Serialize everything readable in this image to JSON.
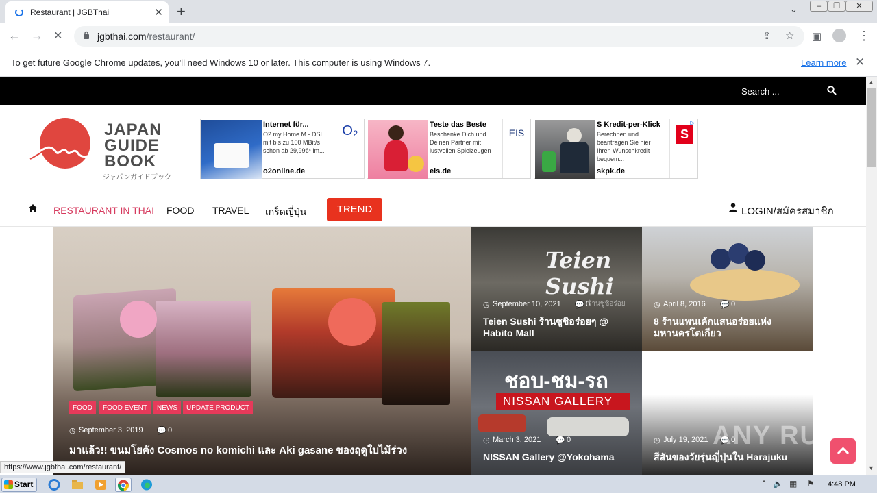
{
  "browser": {
    "tab_title": "Restaurant | JGBThai",
    "url_host": "jgbthai.com",
    "url_path": "/restaurant/",
    "update_message": "To get future Google Chrome updates, you'll need Windows 10 or later. This computer is using Windows 7.",
    "learn_more": "Learn more",
    "status_url": "https://www.jgbthai.com/restaurant/"
  },
  "site": {
    "search_placeholder": "Search ...",
    "logo": {
      "line1": "JAPAN",
      "line2": "GUIDE",
      "line3": "BOOK",
      "kana": "ジャパンガイドブック"
    },
    "nav": {
      "restaurant": "RESTAURANT IN THAI",
      "food": "FOOD",
      "travel": "TRAVEL",
      "trivia": "เกร็ดญี่ปุ่น",
      "trend": "TREND",
      "login": "LOGIN/สมัครสมาชิก"
    },
    "ads": [
      {
        "title": "Internet für...",
        "desc": "O2 my Home M - DSL mit bis zu 100 MBit/s schon ab 29,99€* im...",
        "domain": "o2online.de",
        "brand": "O₂"
      },
      {
        "title": "Teste das Beste",
        "desc": "Beschenke Dich und Deinen Partner mit lustvollen Spielzeugen",
        "domain": "eis.de",
        "brand": "EIS"
      },
      {
        "title": "S Kredit-per-Klick",
        "desc": "Berechnen und beantragen Sie hier Ihren Wunschkredit bequem...",
        "domain": "skpk.de",
        "brand": "S"
      }
    ],
    "featured": {
      "tags": [
        "FOOD",
        "FOOD EVENT",
        "NEWS",
        "UPDATE PRODUCT"
      ],
      "date": "September 3, 2019",
      "comments": "0",
      "title": "มาแล้ว!! ขนมโยคัง Cosmos no komichi และ Aki gasane ของฤดูใบไม้ร่วง"
    },
    "tiles": [
      {
        "date": "September 10, 2021",
        "comments": "0",
        "title": "Teien Sushi ร้านซูชิอร่อยๆ @ Habito Mall",
        "sign": "Teien Sushi",
        "watermark": "ร้านซูชิอร่อย"
      },
      {
        "date": "April 8, 2016",
        "comments": "0",
        "title": "8 ร้านแพนเค้กแสนอร่อยแห่งมหานครโตเกียว"
      },
      {
        "date": "March 3, 2021",
        "comments": "0",
        "title": "NISSAN Gallery @Yokohama",
        "sign": "ชอบ-ชม-รถ",
        "sign2": "NISSAN GALLERY"
      },
      {
        "date": "July 19, 2021",
        "comments": "0",
        "title": "สีสันของวัยรุ่นญี่ปุ่นใน Harajuku"
      }
    ]
  },
  "taskbar": {
    "start": "Start",
    "clock": "4:48 PM"
  },
  "overlay": {
    "watermark": "ANY RUN"
  },
  "colors": {
    "accent": "#e8321e",
    "tag": "#e63a5a",
    "nav_active": "#d63a5e",
    "logo_red": "#e0463f"
  }
}
